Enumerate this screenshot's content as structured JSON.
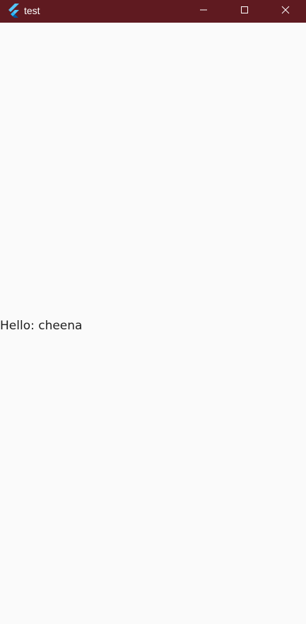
{
  "window": {
    "title": "test",
    "titlebar_color": "#5f1a20",
    "app_icon": "flutter-logo-icon",
    "controls": {
      "minimize_icon": "minimize-icon",
      "maximize_icon": "maximize-icon",
      "close_icon": "close-icon"
    }
  },
  "content": {
    "background": "#fafafa",
    "greeting": "Hello: cheena"
  }
}
